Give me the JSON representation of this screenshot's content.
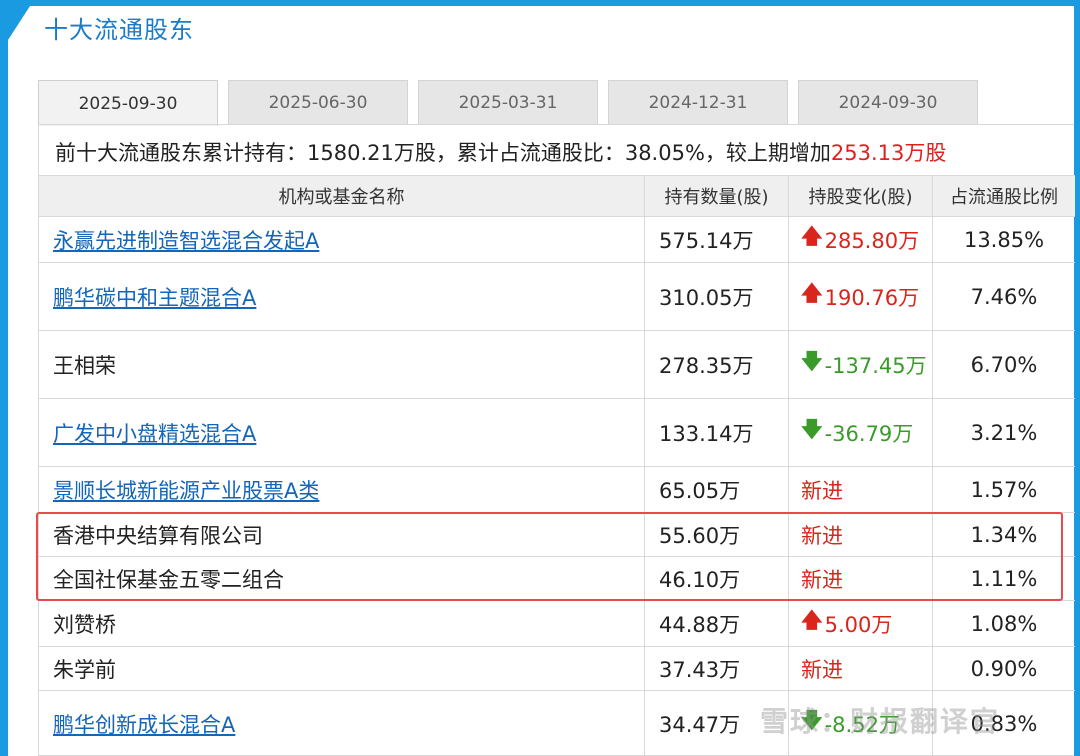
{
  "section": {
    "title": "十大流通股东"
  },
  "tabs": [
    {
      "label": "2025-09-30",
      "active": true
    },
    {
      "label": "2025-06-30",
      "active": false
    },
    {
      "label": "2025-03-31",
      "active": false
    },
    {
      "label": "2024-12-31",
      "active": false
    },
    {
      "label": "2024-09-30",
      "active": false
    }
  ],
  "summary": {
    "part1": "前十大流通股东累计持有：1580.21万股，累计占流通股比：38.05%，较上期增加",
    "increase": "253.13万股"
  },
  "table": {
    "headers": [
      "机构或基金名称",
      "持有数量(股)",
      "持股变化(股)",
      "占流通股比例"
    ],
    "rows": [
      {
        "name": "永赢先进制造智选混合发起A",
        "link": true,
        "qty": "575.14万",
        "change": "285.80万",
        "dir": "up",
        "ratio": "13.85%"
      },
      {
        "name": "鹏华碳中和主题混合A",
        "link": true,
        "qty": "310.05万",
        "change": "190.76万",
        "dir": "up",
        "ratio": "7.46%"
      },
      {
        "name": "王相荣",
        "link": false,
        "qty": "278.35万",
        "change": "-137.45万",
        "dir": "down",
        "ratio": "6.70%"
      },
      {
        "name": "广发中小盘精选混合A",
        "link": true,
        "qty": "133.14万",
        "change": "-36.79万",
        "dir": "down",
        "ratio": "3.21%"
      },
      {
        "name": "景顺长城新能源产业股票A类",
        "link": true,
        "qty": "65.05万",
        "change": "新进",
        "dir": "new",
        "ratio": "1.57%"
      },
      {
        "name": "香港中央结算有限公司",
        "link": false,
        "qty": "55.60万",
        "change": "新进",
        "dir": "new",
        "ratio": "1.34%"
      },
      {
        "name": "全国社保基金五零二组合",
        "link": false,
        "qty": "46.10万",
        "change": "新进",
        "dir": "new",
        "ratio": "1.11%"
      },
      {
        "name": "刘赞桥",
        "link": false,
        "qty": "44.88万",
        "change": "5.00万",
        "dir": "up",
        "ratio": "1.08%"
      },
      {
        "name": "朱学前",
        "link": false,
        "qty": "37.43万",
        "change": "新进",
        "dir": "new",
        "ratio": "0.90%"
      },
      {
        "name": "鹏华创新成长混合A",
        "link": true,
        "qty": "34.47万",
        "change": "-8.52万",
        "dir": "down",
        "ratio": "0.83%"
      }
    ]
  },
  "colors": {
    "accent": "#1a9ae0",
    "up": "#d8261c",
    "down": "#3a9a2a",
    "highlight": "#e84b4b"
  },
  "watermark": "雪球：财报翻译官"
}
